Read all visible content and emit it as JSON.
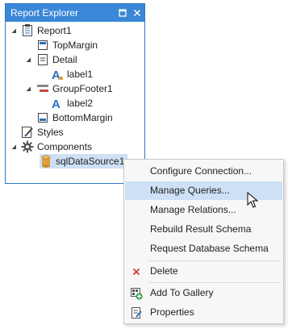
{
  "panel": {
    "title": "Report Explorer",
    "pin_icon": "dock-window-icon",
    "close_icon": "close-icon",
    "tree": [
      {
        "label": "Report1",
        "icon": "report-icon",
        "expanded": true
      },
      {
        "label": "TopMargin",
        "icon": "band-icon"
      },
      {
        "label": "Detail",
        "icon": "band-icon",
        "expanded": true
      },
      {
        "label": "label1",
        "icon": "label-control-icon"
      },
      {
        "label": "GroupFooter1",
        "icon": "group-band-icon",
        "expanded": true
      },
      {
        "label": "label2",
        "icon": "label-control-icon"
      },
      {
        "label": "BottomMargin",
        "icon": "band-icon"
      },
      {
        "label": "Styles",
        "icon": "styles-icon"
      },
      {
        "label": "Components",
        "icon": "gear-icon",
        "expanded": true
      },
      {
        "label": "sqlDataSource1",
        "icon": "database-icon",
        "selected": true
      }
    ]
  },
  "context_menu": {
    "items": [
      {
        "label": "Configure Connection...",
        "icon": ""
      },
      {
        "label": "Manage Queries...",
        "icon": "",
        "highlighted": true
      },
      {
        "label": "Manage Relations...",
        "icon": ""
      },
      {
        "label": "Rebuild Result Schema",
        "icon": ""
      },
      {
        "label": "Request Database Schema",
        "icon": ""
      },
      {
        "label": "Delete",
        "icon": "delete-x-icon"
      },
      {
        "label": "Add To Gallery",
        "icon": "add-to-gallery-icon"
      },
      {
        "label": "Properties",
        "icon": "properties-icon"
      }
    ]
  },
  "colors": {
    "title_bar": "#3a87d7",
    "selection": "#cfe0f5",
    "menu_highlight": "#cde0f6",
    "delete_red": "#d23a3a",
    "icon_blue": "#2a6fb8"
  }
}
